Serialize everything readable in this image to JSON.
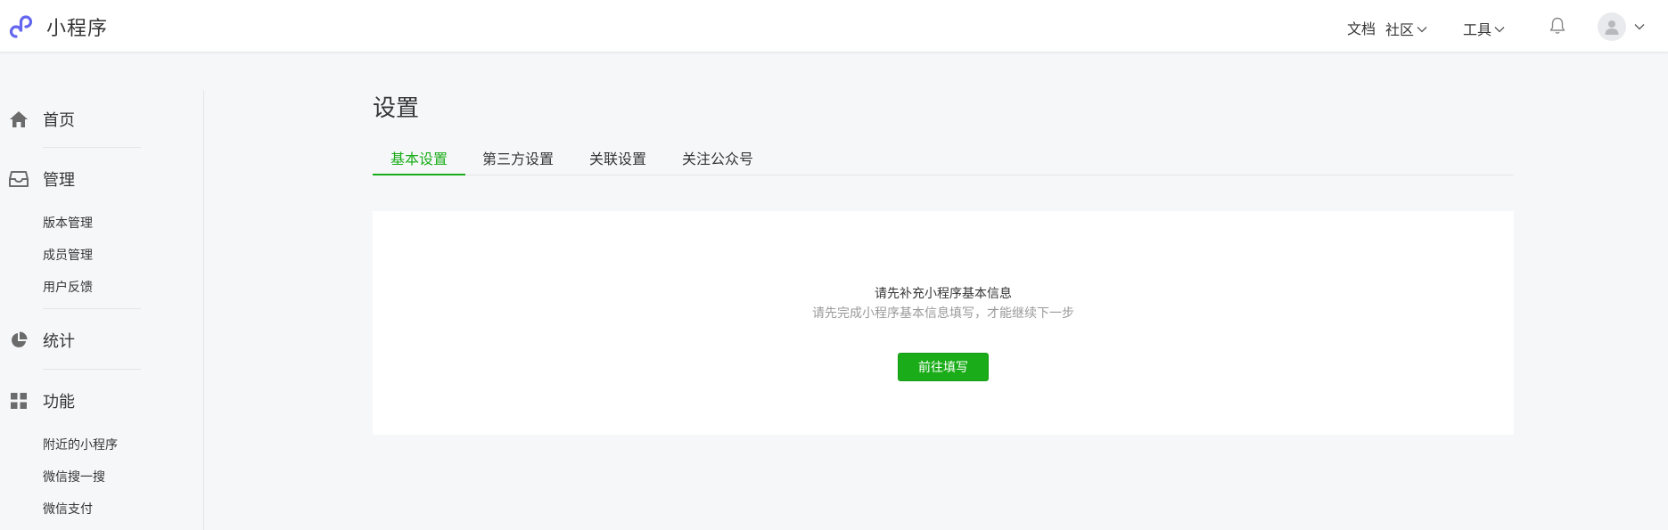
{
  "header": {
    "app_name": "小程序",
    "nav": {
      "docs": "文档",
      "community": "社区",
      "tools": "工具"
    },
    "icons": {
      "logo": "mini-program-logo-icon",
      "bell": "bell-icon",
      "avatar": "user-avatar-icon",
      "chevron": "chevron-down-icon"
    }
  },
  "sidebar": {
    "home": "首页",
    "manage": {
      "label": "管理",
      "items": [
        "版本管理",
        "成员管理",
        "用户反馈"
      ]
    },
    "stats": "统计",
    "features": {
      "label": "功能",
      "items": [
        "附近的小程序",
        "微信搜一搜",
        "微信支付"
      ]
    }
  },
  "main": {
    "title": "设置",
    "tabs": [
      "基本设置",
      "第三方设置",
      "关联设置",
      "关注公众号"
    ],
    "active_tab": 0,
    "card": {
      "title": "请先补充小程序基本信息",
      "description": "请先完成小程序基本信息填写，才能继续下一步",
      "button": "前往填写"
    }
  },
  "colors": {
    "accent": "#1aad19",
    "logo": "#6467f0",
    "background": "#f6f7f9"
  }
}
